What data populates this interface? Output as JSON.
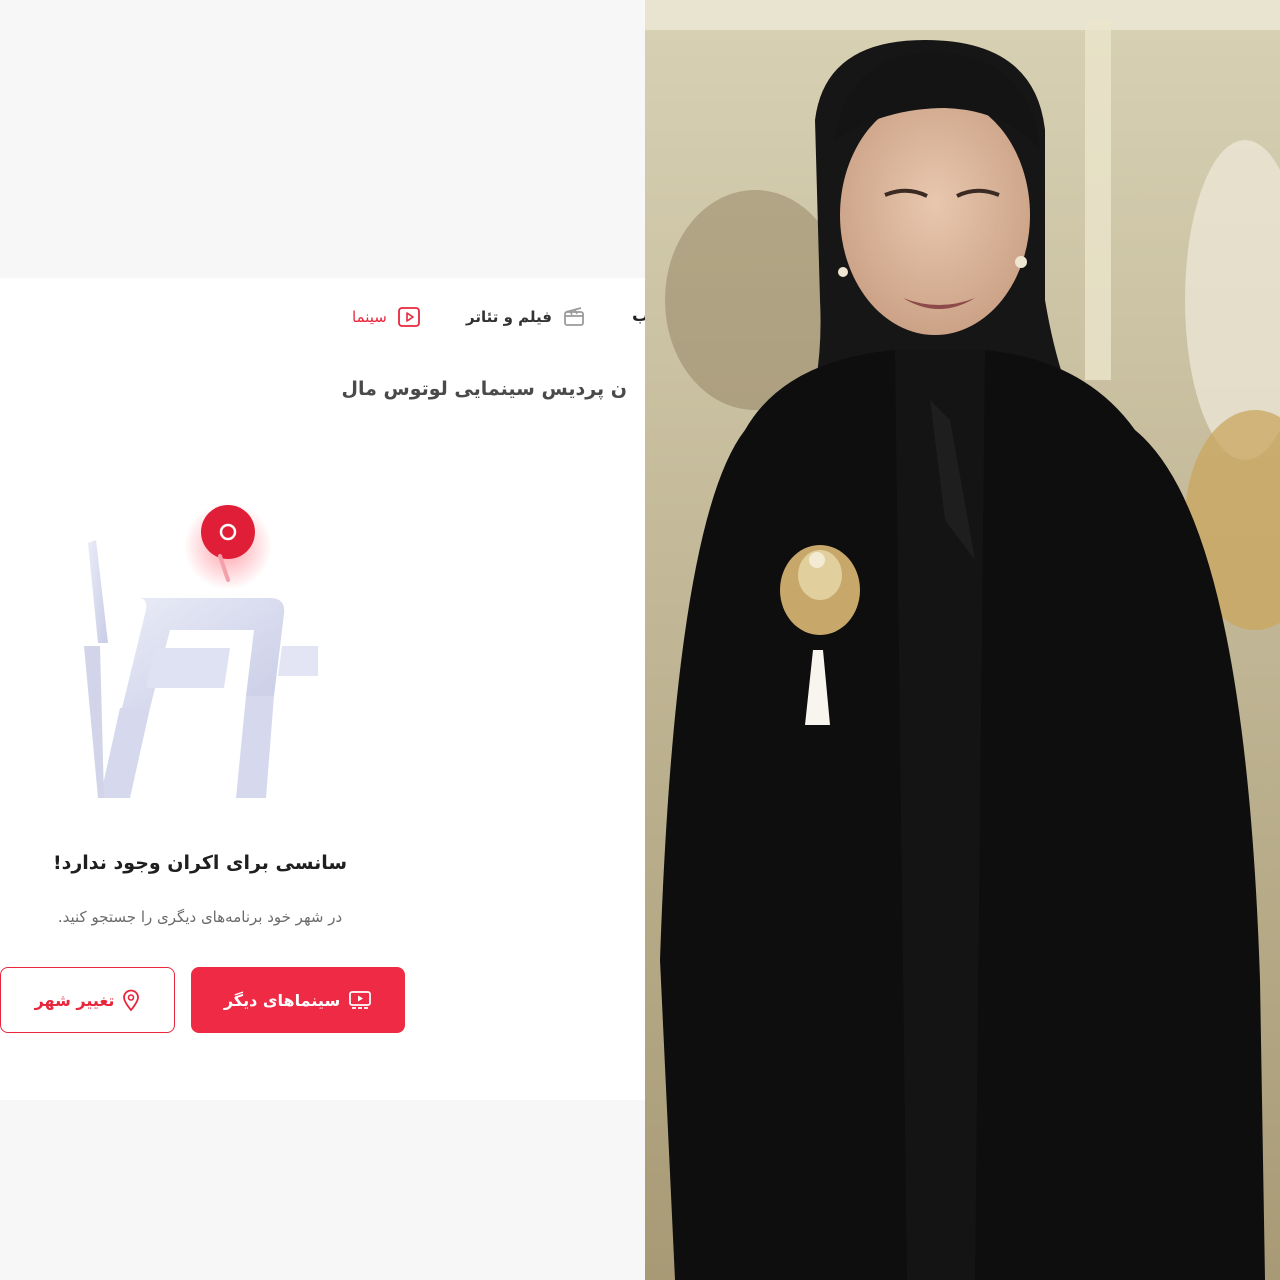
{
  "nav": {
    "cinema_label": "سینما",
    "film_theater_label": "فیلم و تئاتر",
    "cut_label": "ب"
  },
  "venue": {
    "title": "ن پردیس سینمایی لوتوس مال"
  },
  "empty_state": {
    "title": "سانسی برای اکران وجود ندارد!",
    "subtitle": "در شهر خود برنامه‌های دیگری را جستجو کنید."
  },
  "buttons": {
    "other_cinemas": "سینماهای دیگر",
    "change_city": "تغییر شهر"
  },
  "colors": {
    "accent": "#ee2a44",
    "text_dark": "#1f1f1f",
    "text_muted": "#6b6b6b"
  },
  "icons": {
    "cinema": "play-square-icon",
    "film_theater": "clapperboard-icon",
    "other_cinemas": "cinema-screen-icon",
    "change_city": "map-pin-icon"
  }
}
